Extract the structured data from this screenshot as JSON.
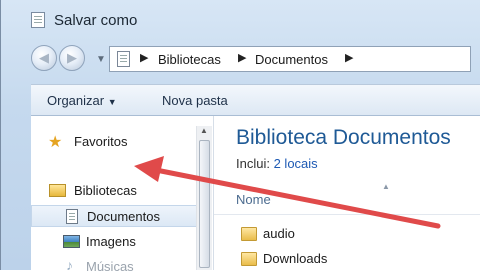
{
  "window": {
    "title": "Salvar como"
  },
  "address_bar": {
    "crumbs": [
      "Bibliotecas",
      "Documentos"
    ]
  },
  "toolbar": {
    "organize_label": "Organizar",
    "new_folder_label": "Nova pasta"
  },
  "sidebar": {
    "favorites_label": "Favoritos",
    "libraries_label": "Bibliotecas",
    "items": [
      {
        "label": "Documentos",
        "icon": "document-icon",
        "selected": true
      },
      {
        "label": "Imagens",
        "icon": "pictures-icon",
        "selected": false
      },
      {
        "label": "Músicas",
        "icon": "music-icon",
        "selected": false
      }
    ]
  },
  "content": {
    "title": "Biblioteca Documentos",
    "includes_label": "Inclui:",
    "includes_link": "2 locais",
    "column_name": "Nome",
    "files": [
      {
        "name": "audio",
        "type": "folder"
      },
      {
        "name": "Downloads",
        "type": "folder"
      }
    ]
  },
  "annotation": {
    "arrow_color": "#e04a4a"
  },
  "colors": {
    "title_blue": "#1f5a96",
    "link_blue": "#1e5ab4",
    "frame_blue": "#c5d9ee"
  }
}
